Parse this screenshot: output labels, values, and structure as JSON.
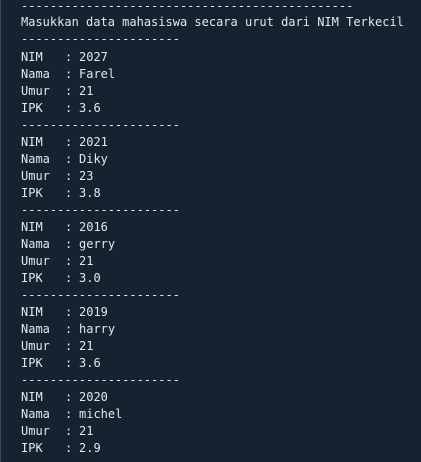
{
  "terminal": {
    "top_divider": "----------------------------------------------",
    "header": "Masukkan data mahasiswa secara urut dari NIM Terkecil",
    "divider": "----------------------",
    "labels": {
      "nim": "NIM",
      "nama": "Nama",
      "umur": "Umur",
      "ipk": "IPK"
    },
    "separator": ":",
    "records": [
      {
        "nim": "2027",
        "nama": "Farel",
        "umur": "21",
        "ipk": "3.6"
      },
      {
        "nim": "2021",
        "nama": "Diky",
        "umur": "23",
        "ipk": "3.8"
      },
      {
        "nim": "2016",
        "nama": "gerry",
        "umur": "21",
        "ipk": "3.0"
      },
      {
        "nim": "2019",
        "nama": "harry",
        "umur": "21",
        "ipk": "3.6"
      },
      {
        "nim": "2020",
        "nama": "michel",
        "umur": "21",
        "ipk": "2.9"
      }
    ]
  }
}
